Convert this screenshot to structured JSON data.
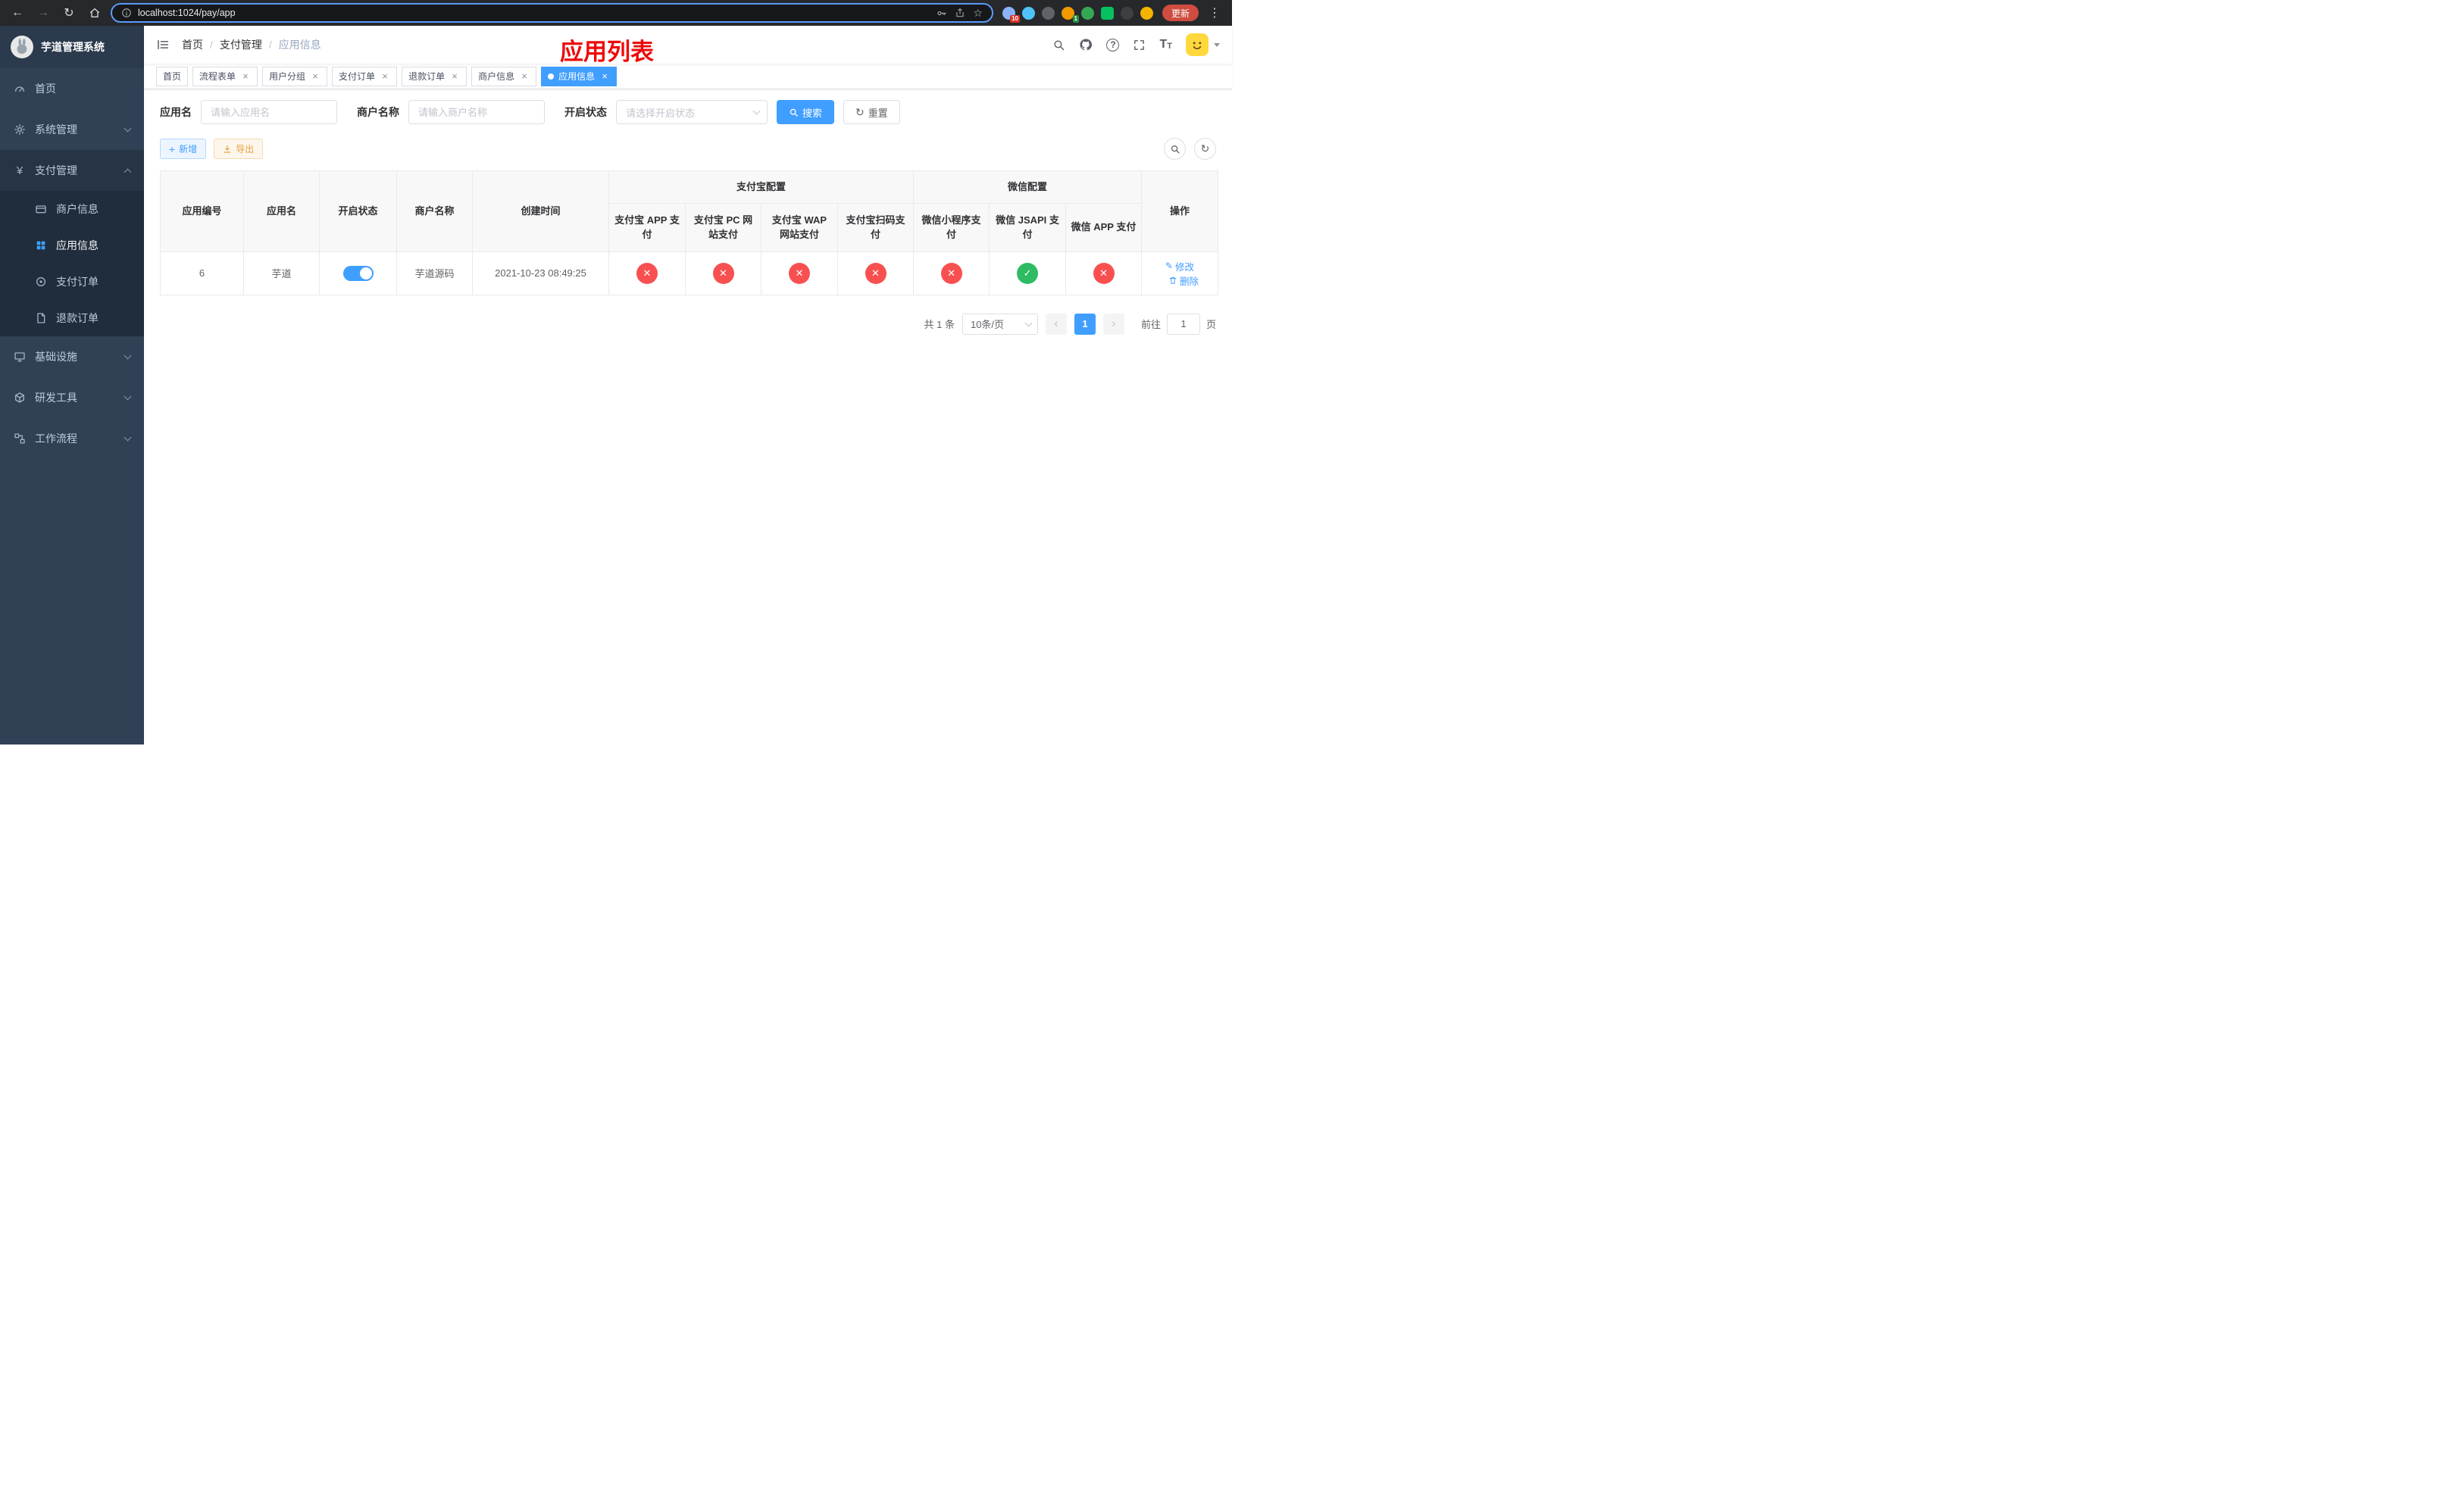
{
  "colors": {
    "accent": "#409eff",
    "danger": "#f85050",
    "success": "#2ebb62",
    "warning": "#e6a23c",
    "sidebar_bg": "#304156",
    "submenu_bg": "#1f2d3d",
    "annotation_red": "#ee0a0a",
    "update_button_bg": "#cf4c3f"
  },
  "glyphs": {
    "back": "←",
    "forward": "→",
    "reload": "↻",
    "kebab": "⋮",
    "star": "☆",
    "close": "×",
    "plus": "+",
    "refresh": "↻",
    "yen": "¥",
    "question": "?",
    "text_large": "T",
    "text_small": "T",
    "prev": "‹",
    "next": "›",
    "edit": "✎"
  },
  "browser": {
    "url": "localhost:1024/pay/app",
    "update_label": "更新",
    "extension_badge_1": "10",
    "extension_badge_2": "1"
  },
  "sidebar": {
    "logo_title": "芋道管理系统",
    "items": [
      {
        "label": "首页"
      },
      {
        "label": "系统管理"
      },
      {
        "label": "支付管理"
      },
      {
        "label": "基础设施"
      },
      {
        "label": "研发工具"
      },
      {
        "label": "工作流程"
      }
    ],
    "pay_children": [
      {
        "label": "商户信息"
      },
      {
        "label": "应用信息"
      },
      {
        "label": "支付订单"
      },
      {
        "label": "退款订单"
      }
    ]
  },
  "navbar": {
    "breadcrumb": {
      "items": [
        "首页",
        "支付管理",
        "应用信息"
      ],
      "separator": "/"
    }
  },
  "annotation": {
    "title": "应用列表"
  },
  "tags": [
    {
      "label": "首页"
    },
    {
      "label": "流程表单"
    },
    {
      "label": "用户分组"
    },
    {
      "label": "支付订单"
    },
    {
      "label": "退款订单"
    },
    {
      "label": "商户信息"
    },
    {
      "label": "应用信息"
    }
  ],
  "filters": {
    "app_name_label": "应用名",
    "app_name_placeholder": "请输入应用名",
    "merchant_label": "商户名称",
    "merchant_placeholder": "请输入商户名称",
    "status_label": "开启状态",
    "status_placeholder": "请选择开启状态",
    "search_button": "搜索",
    "reset_button": "重置"
  },
  "toolbar": {
    "add_label": "新增",
    "export_label": "导出"
  },
  "table": {
    "groups": {
      "alipay": "支付宝配置",
      "wechat": "微信配置"
    },
    "plain_columns": [
      "应用编号",
      "应用名",
      "开启状态",
      "商户名称",
      "创建时间"
    ],
    "alipay_columns": [
      "支付宝 APP 支付",
      "支付宝 PC 网站支付",
      "支付宝 WAP 网站支付",
      "支付宝扫码支付"
    ],
    "wechat_columns": [
      "微信小程序支付",
      "微信 JSAPI 支付",
      "微信 APP 支付"
    ],
    "ops_column": "操作",
    "rows": [
      {
        "app_id": "6",
        "app_name": "芋道",
        "status_on": true,
        "merchant_name": "芋道源码",
        "create_time": "2021-10-23 08:49:25",
        "configs": [
          "no",
          "no",
          "no",
          "no",
          "no",
          "yes",
          "no"
        ],
        "edit_label": "修改",
        "delete_label": "删除"
      }
    ]
  },
  "pagination": {
    "total_text": "共 1 条",
    "page_size_text": "10条/页",
    "current_page": "1",
    "goto_prefix": "前往",
    "goto_value": "1",
    "goto_suffix": "页"
  }
}
